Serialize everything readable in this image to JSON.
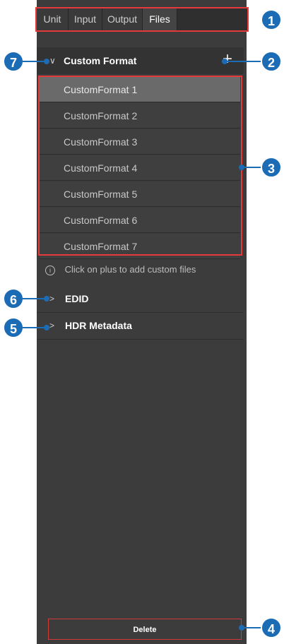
{
  "tabs": [
    {
      "label": "Unit"
    },
    {
      "label": "Input"
    },
    {
      "label": "Output"
    },
    {
      "label": "Files"
    }
  ],
  "custom_format": {
    "title": "Custom Format",
    "add_icon": "plus-icon",
    "items": [
      "CustomFormat 1",
      "CustomFormat 2",
      "CustomFormat 3",
      "CustomFormat 4",
      "CustomFormat 5",
      "CustomFormat 6",
      "CustomFormat 7"
    ]
  },
  "info_text": "Click on plus to add custom files",
  "sections": [
    {
      "label": "EDID"
    },
    {
      "label": "HDR Metadata"
    }
  ],
  "delete_label": "Delete",
  "callouts": [
    "1",
    "2",
    "3",
    "4",
    "5",
    "6",
    "7"
  ],
  "colors": {
    "panel": "#3c3c3c",
    "highlight": "#e63a3a",
    "callout": "#1c6cb5",
    "selected_row": "#6a6a6a"
  }
}
